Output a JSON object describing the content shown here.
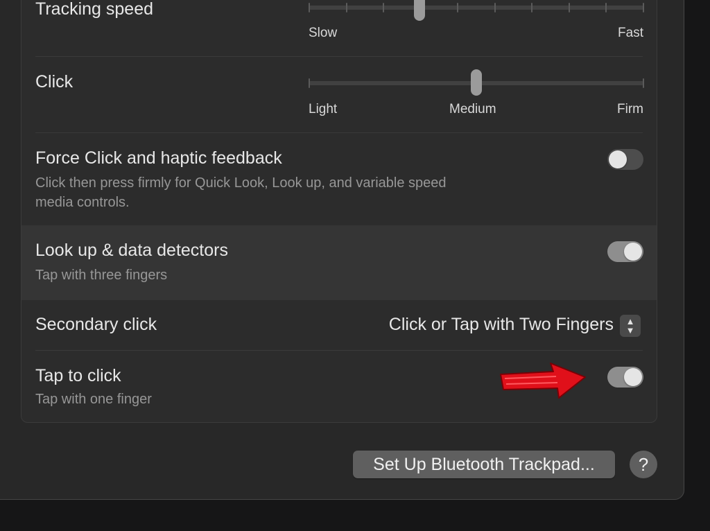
{
  "tracking": {
    "label": "Tracking speed",
    "min_label": "Slow",
    "max_label": "Fast",
    "value": 0.33
  },
  "click": {
    "label": "Click",
    "labels": [
      "Light",
      "Medium",
      "Firm"
    ],
    "value": 0.5
  },
  "force_click": {
    "label": "Force Click and haptic feedback",
    "description_line1": "Click then press firmly for Quick Look, Look up, and variable speed",
    "description_line2": "media controls.",
    "enabled": false
  },
  "look_up": {
    "label": "Look up & data detectors",
    "description": "Tap with three fingers",
    "enabled": true
  },
  "secondary_click": {
    "label": "Secondary click",
    "value": "Click or Tap with Two Fingers",
    "stepper_up": "▲",
    "stepper_down": "▼"
  },
  "tap_to_click": {
    "label": "Tap to click",
    "description": "Tap with one finger",
    "enabled": true
  },
  "annotation": {
    "color": "#e0101a",
    "icon": "red-arrow-pointing-right"
  },
  "footer": {
    "setup_button": "Set Up Bluetooth Trackpad...",
    "help_button": "?"
  }
}
